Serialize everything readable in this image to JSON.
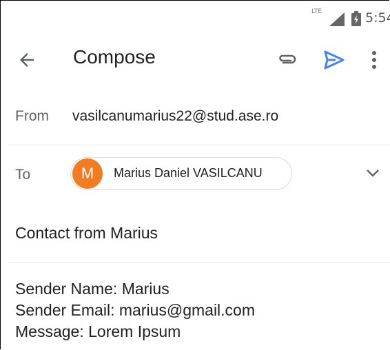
{
  "status_bar": {
    "network": "LTE",
    "time": "5:54"
  },
  "app_bar": {
    "title": "Compose",
    "icons": [
      "arrow-back-icon",
      "paperclip-icon",
      "send-icon",
      "more-vert-icon"
    ],
    "send_color": "#4285f4"
  },
  "from": {
    "label": "From",
    "value": "vasilcanumarius22@stud.ase.ro"
  },
  "to": {
    "label": "To",
    "recipient": {
      "initial": "M",
      "name": "Marius Daniel VASILCANU",
      "avatar_color": "#f47c20"
    }
  },
  "subject": "Contact from Marius",
  "body": {
    "lines": [
      "Sender Name: Marius",
      "Sender Email: marius@gmail.com",
      "Message: Lorem Ipsum"
    ]
  }
}
